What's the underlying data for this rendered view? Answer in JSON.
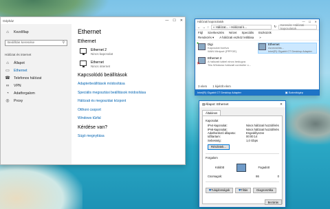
{
  "settings": {
    "title": "Gépház",
    "home": "Kezdőlap",
    "search_placeholder": "Beállítás keresése",
    "section": "Hálózat és internet",
    "nav": [
      {
        "icon": "status-icon",
        "label": "Állapot"
      },
      {
        "icon": "ethernet-icon",
        "label": "Ethernet"
      },
      {
        "icon": "phone-icon",
        "label": "Telefonos hálózat"
      },
      {
        "icon": "vpn-icon",
        "label": "VPN"
      },
      {
        "icon": "data-usage-icon",
        "label": "Adatforgalom"
      },
      {
        "icon": "proxy-icon",
        "label": "Proxy"
      }
    ],
    "page_title": "Ethernet",
    "subheading": "Ethernet",
    "adapters": [
      {
        "name": "Ethernet 2",
        "status": "Nincs kapcsolat"
      },
      {
        "name": "Ethernet",
        "status": "Nincs internet"
      }
    ],
    "related_title": "Kapcsolódó beállítások",
    "related_links": [
      "Adapterbeállítások módosítása",
      "Speciális megosztási beállítások módosítása",
      "Hálózati és megosztási központ",
      "Otthoni csoport",
      "Windows tűzfal"
    ],
    "question": "Kérdése van?",
    "help_link": "Súgó megnyitása"
  },
  "netconn": {
    "title": "Hálózati kapcsolatok",
    "path": "« Hálózat... › Hálózati k...",
    "search": "Keresés: Hálózati kapcsolatok",
    "menu": [
      "Fájl",
      "Szerkesztés",
      "Nézet",
      "Speciális",
      "Eszközök"
    ],
    "toolbar": [
      "Rendezés ▾",
      "A hálózati eszköz letiltása",
      "»"
    ],
    "items": [
      {
        "name": "Digi",
        "l1": "Kapcsolat bontva",
        "l2": "WAN Miniport (PPPOE)"
      },
      {
        "name": "Ethernet",
        "l1": "Azonosítás...",
        "l2": "Intel(R) Gigabit CT Desktop Adapter"
      },
      {
        "name": "Ethernet 2",
        "l1": "A hálózati kábel nincs bedugva",
        "l2": "TAs Windows hálózati controller c..."
      }
    ],
    "status": [
      "3 elem",
      "1 kijelölt elem"
    ],
    "detail_left": "Intel(R) Gigabit CT Desktop Adapter",
    "detail_right": "Számítógép"
  },
  "dialog": {
    "title": "Állapot: Ethernet",
    "tab": "Általános",
    "group_conn": "Kapcsolat",
    "rows": [
      {
        "k": "IPv4-kapcsolat:",
        "v": "Nincs hálózati hozzáférés"
      },
      {
        "k": "IPv6-kapcsolat:",
        "v": "Nincs hálózati hozzáférés"
      },
      {
        "k": "Adathordozó állapota:",
        "v": "Engedélyezve"
      },
      {
        "k": "Időtartam:",
        "v": "00:00:14"
      },
      {
        "k": "Sebesség:",
        "v": "1,0 Gbps"
      }
    ],
    "details_btn": "Részletek...",
    "group_activity": "Forgalom",
    "sent_label": "Küldött",
    "recv_label": "Fogadott",
    "bytes_label": "Csomagok:",
    "bytes_sent": "86",
    "bytes_recv": "0",
    "btn_properties": "Tulajdonságok",
    "btn_disable": "Tiltás",
    "btn_diagnose": "Diagnosztika",
    "btn_close": "Bezárás"
  }
}
